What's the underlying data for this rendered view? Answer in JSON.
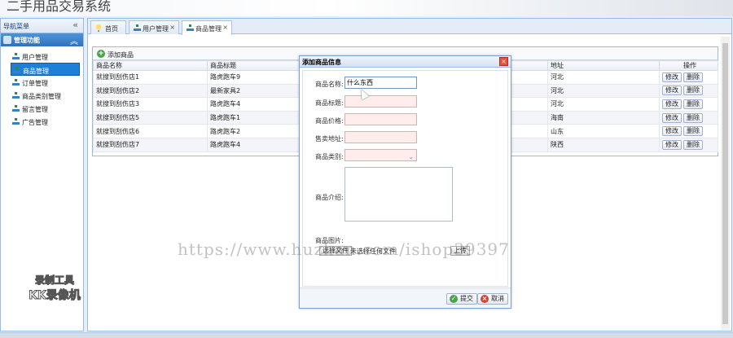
{
  "app": {
    "title": "二手用品交易系统"
  },
  "sidebar": {
    "header": "导航菜单",
    "collapse_glyph": "«",
    "group": {
      "label": "管理功能",
      "toggle_glyph": "︽"
    },
    "items": [
      {
        "label": "用户管理"
      },
      {
        "label": "商品管理"
      },
      {
        "label": "订单管理"
      },
      {
        "label": "商品类别管理"
      },
      {
        "label": "留言管理"
      },
      {
        "label": "广告管理"
      }
    ]
  },
  "tabs": [
    {
      "label": "首页"
    },
    {
      "label": "用户管理",
      "close": "×"
    },
    {
      "label": "商品管理",
      "close": "×"
    }
  ],
  "toolbar": {
    "add_label": "添加商品",
    "add_glyph": "+"
  },
  "grid": {
    "columns": {
      "name": "商品名称",
      "title": "商品标题",
      "address": "地址",
      "ops": "操作"
    },
    "rows": [
      {
        "name": "就搜到刮伤店1",
        "title": "路虎跑车9",
        "address": "河北"
      },
      {
        "name": "就搜到刮伤店2",
        "title": "最新家具2",
        "address": "河北"
      },
      {
        "name": "就搜到刮伤店3",
        "title": "路虎跑车4",
        "address": "河北"
      },
      {
        "name": "就搜到刮伤店5",
        "title": "路虎跑车1",
        "address": "海南"
      },
      {
        "name": "就搜到刮伤店6",
        "title": "路虎跑车2",
        "address": "山东"
      },
      {
        "name": "就搜到刮伤店7",
        "title": "路虎跑车4",
        "address": "陕西"
      }
    ],
    "edit_label": "修改",
    "delete_label": "删除"
  },
  "dialog": {
    "title": "添加商品信息",
    "close_glyph": "×",
    "fields": {
      "name_label": "商品名称:",
      "name_value": "什么东西",
      "title_label": "商品标题:",
      "price_label": "商品价格:",
      "address_label": "售卖地址:",
      "category_label": "商品类别:",
      "category_arrow": "⌄",
      "intro_label": "商品介绍:",
      "image_label": "商品图片:",
      "file_button": "选择文件",
      "file_status": "未选择任何文件",
      "upload_button": "上传"
    },
    "submit_label": "提交",
    "submit_glyph": "✓",
    "cancel_label": "取消",
    "cancel_glyph": "×"
  },
  "overlay": {
    "watermark": "https://www.huzhan.com/ishop39397",
    "recorder_line1": "录制工具",
    "recorder_line2": "KK录像机"
  }
}
